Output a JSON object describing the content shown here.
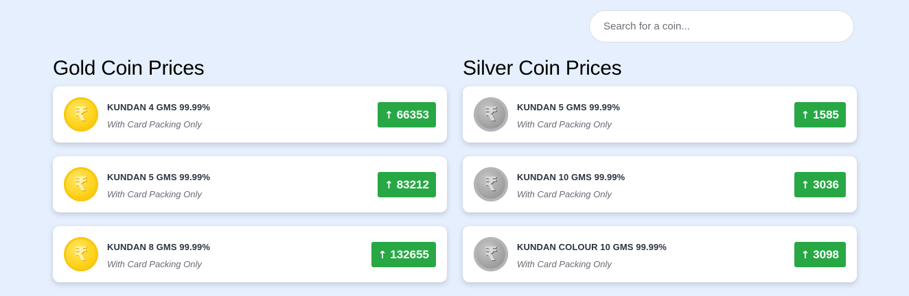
{
  "search": {
    "placeholder": "Search for a coin...",
    "value": ""
  },
  "gold": {
    "title": "Gold Coin Prices",
    "items": [
      {
        "name": "KUNDAN 4 GMS 99.99%",
        "note": "With Card Packing Only",
        "price": "66353",
        "trend_icon": "arrow-up-icon"
      },
      {
        "name": "KUNDAN 5 GMS 99.99%",
        "note": "With Card Packing Only",
        "price": "83212",
        "trend_icon": "arrow-up-icon"
      },
      {
        "name": "KUNDAN 8 GMS 99.99%",
        "note": "With Card Packing Only",
        "price": "132655",
        "trend_icon": "arrow-up-icon"
      }
    ]
  },
  "silver": {
    "title": "Silver Coin Prices",
    "items": [
      {
        "name": "KUNDAN 5 GMS 99.99%",
        "note": "With Card Packing Only",
        "price": "1585",
        "trend_icon": "arrow-up-icon"
      },
      {
        "name": "KUNDAN 10 GMS 99.99%",
        "note": "With Card Packing Only",
        "price": "3036",
        "trend_icon": "arrow-up-icon"
      },
      {
        "name": "KUNDAN COLOUR 10 GMS 99.99%",
        "note": "With Card Packing Only",
        "price": "3098",
        "trend_icon": "arrow-up-icon"
      }
    ]
  },
  "colors": {
    "background": "#e6effd",
    "price_badge": "#28a745",
    "gold_coin": "#ffd21a",
    "silver_coin": "#9e9e9e"
  },
  "icons": {
    "coin": "rupee-coin-icon",
    "trend": "arrow-up-icon"
  }
}
